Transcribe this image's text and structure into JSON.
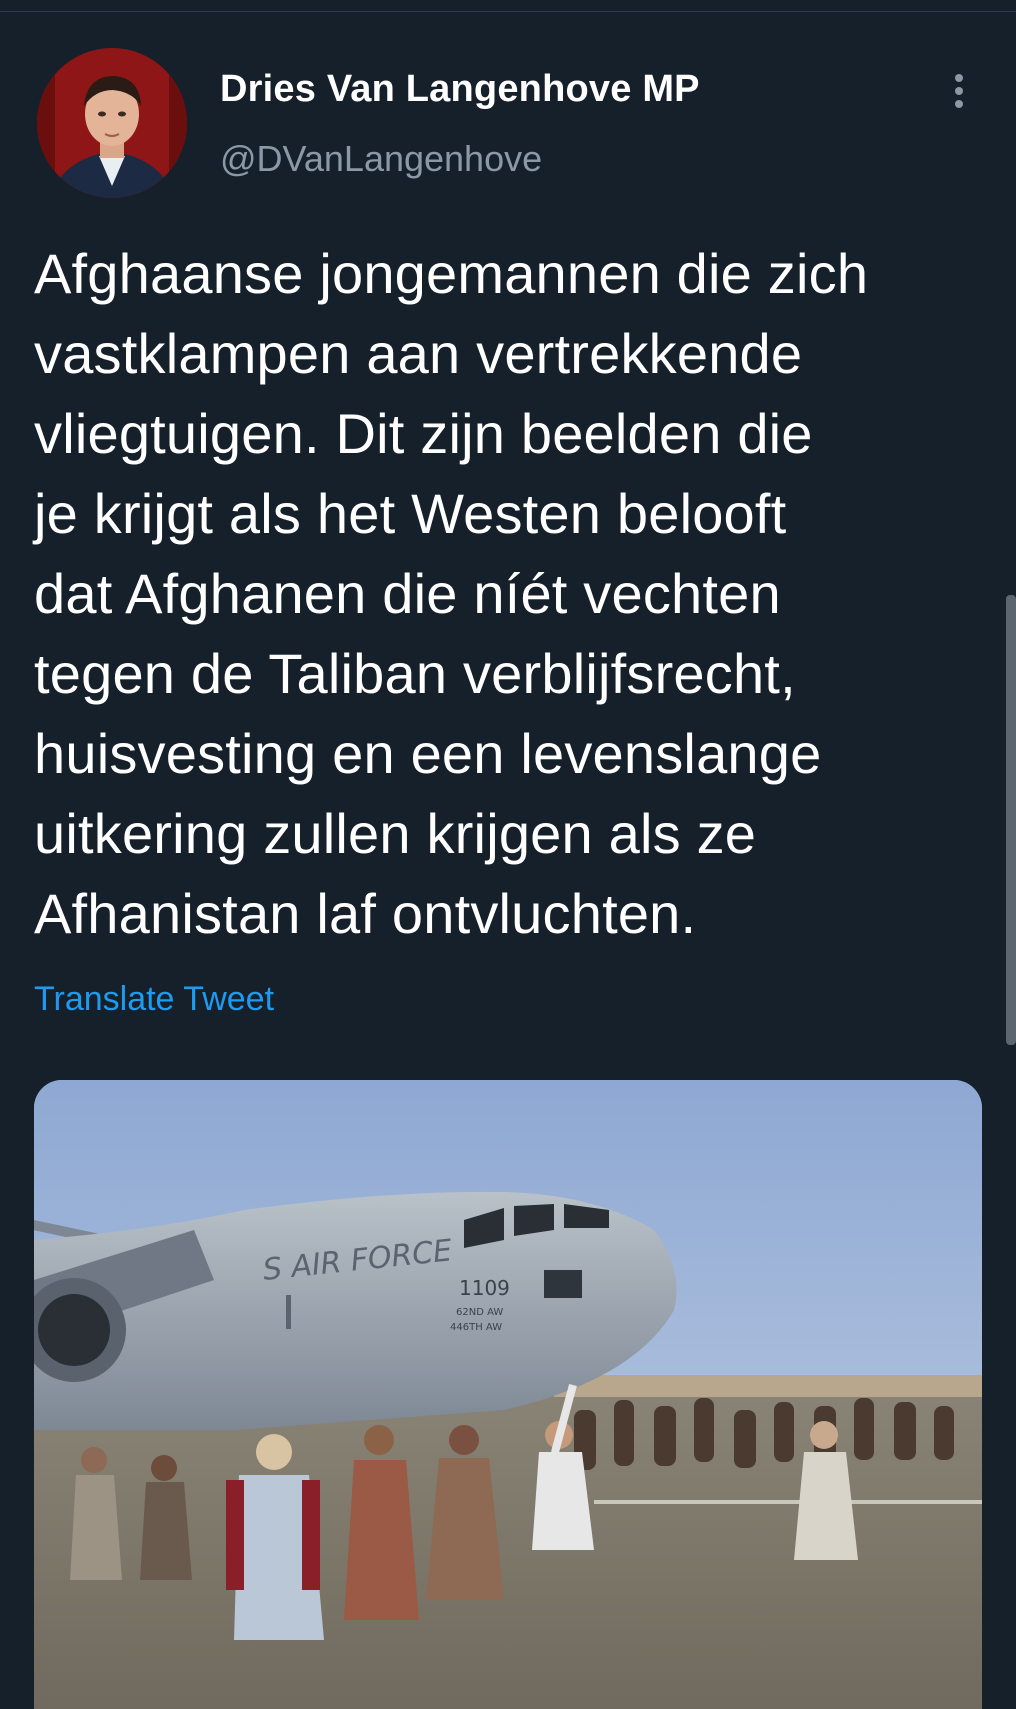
{
  "tweet": {
    "author_name": "Dries Van Langenhove MP",
    "author_handle": "@DVanLangenhove",
    "text": "Afghaanse jongemannen die zich\nvastklampen aan vertrekkende\nvliegtuigen. Dit zijn beelden die\nje krijgt als het Westen belooft\ndat Afghanen die níét vechten\ntegen de Taliban verblijfsrecht,\nhuisvesting en een levenslange\nuitkering zullen krijgen als ze\nAfhanistan laf ontvluchten.",
    "translate_label": "Translate Tweet",
    "media_text": {
      "aircraft_marking": "S AIR FORCE",
      "tail_number": "1109",
      "wing_1": "62ND AW",
      "wing_2": "446TH AW"
    }
  },
  "icons": {
    "more": "more-options-icon"
  },
  "colors": {
    "background": "#15202b",
    "primary_text": "#ffffff",
    "secondary_text": "#8b98a5",
    "link": "#1d9bf0"
  }
}
